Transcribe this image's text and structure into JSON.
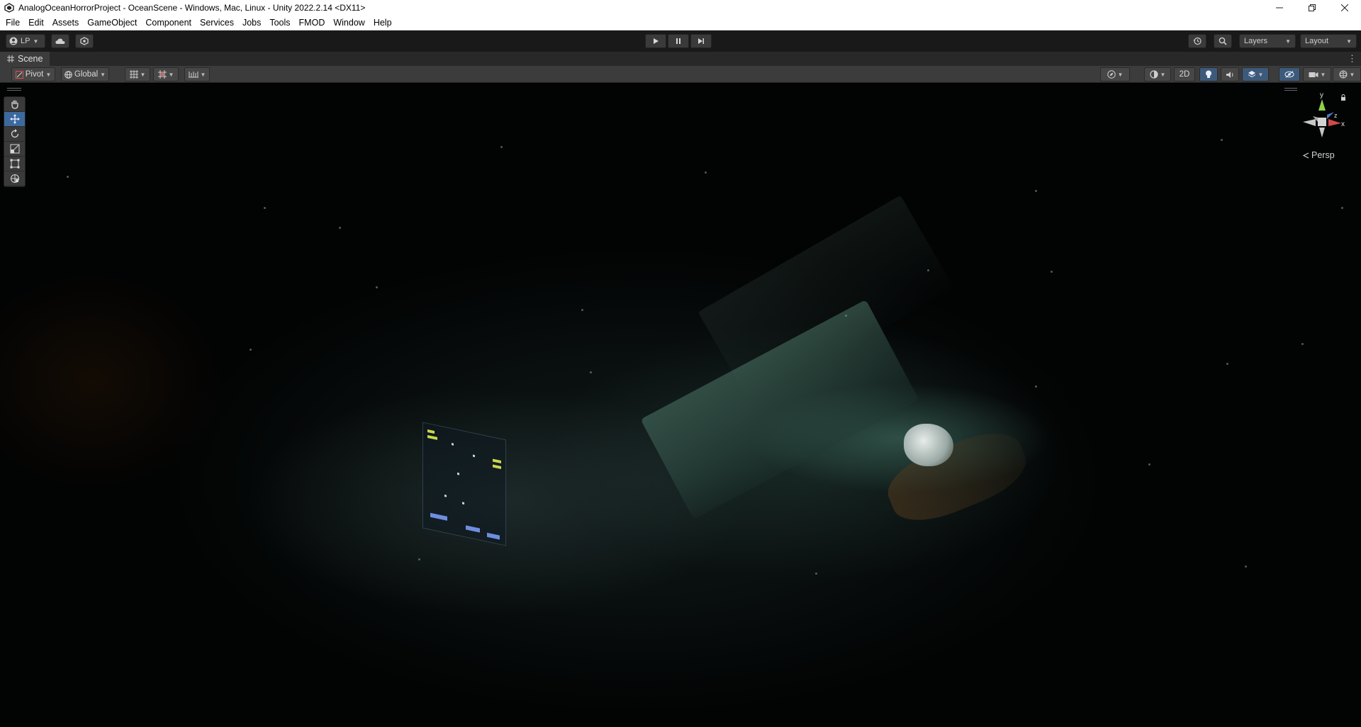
{
  "window": {
    "title": "AnalogOceanHorrorProject - OceanScene - Windows, Mac, Linux - Unity 2022.2.14 <DX11>",
    "controls": [
      "minimize-icon",
      "restore-icon",
      "close-icon"
    ]
  },
  "menu": {
    "items": [
      "File",
      "Edit",
      "Assets",
      "GameObject",
      "Component",
      "Services",
      "Jobs",
      "Tools",
      "FMOD",
      "Window",
      "Help"
    ]
  },
  "toolbar": {
    "account_label": "LP",
    "layers_label": "Layers",
    "layout_label": "Layout",
    "icons": [
      "cloud-icon",
      "collab-icon",
      "play-icon",
      "pause-icon",
      "step-icon",
      "history-icon",
      "search-icon"
    ]
  },
  "scene_tab": {
    "label": "Scene"
  },
  "scene_toolbar": {
    "pivot_label": "Pivot",
    "global_label": "Global",
    "mode_2d_label": "2D",
    "colors": {
      "active_blue": "#3d6a9e",
      "toolbar_bg": "#3c3c3c"
    }
  },
  "tools": [
    "hand-tool",
    "move-tool",
    "rotate-tool",
    "scale-tool",
    "rect-tool",
    "transform-tool"
  ],
  "orientation": {
    "y_label": "y",
    "z_label": "z",
    "x_label": "x",
    "projection_label": "Persp",
    "colors": {
      "y": "#8ed14a",
      "x": "#d04a4a",
      "z": "#4a7ad0"
    }
  }
}
